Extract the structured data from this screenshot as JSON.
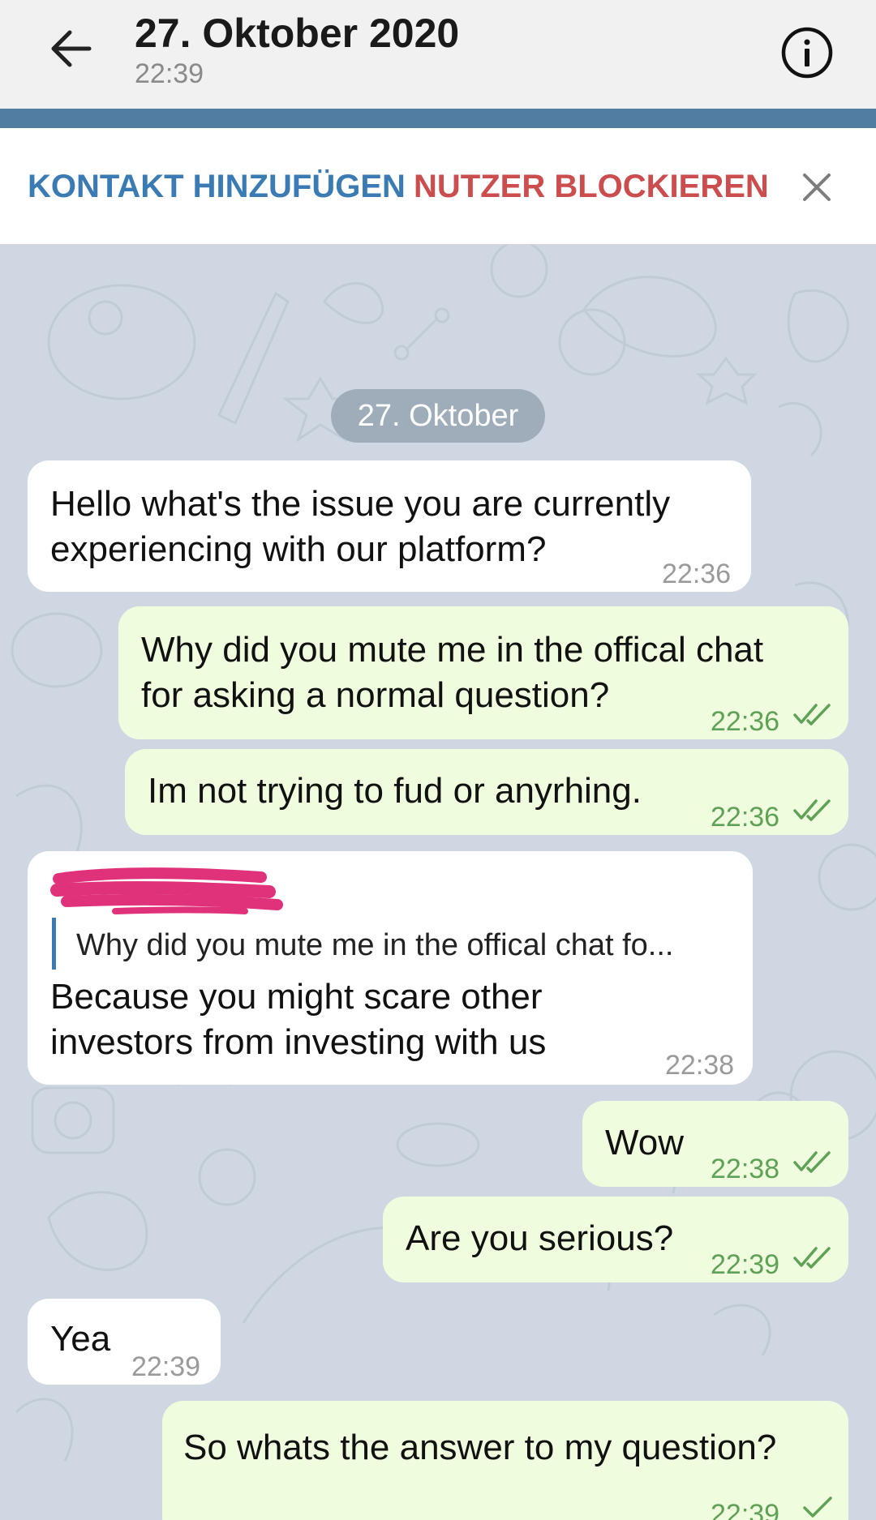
{
  "header": {
    "title": "27. Oktober 2020",
    "subtitle": "22:39",
    "back_icon": "arrow-left-icon",
    "info_icon": "info-circle-icon"
  },
  "actions": {
    "add_contact": "KONTAKT HINZUFÜGEN",
    "block_user": "NUTZER BLOCKIEREN",
    "close_icon": "close-icon"
  },
  "chat": {
    "date_pill": "27. Oktober",
    "messages": [
      {
        "direction": "in",
        "text": "Hello what's the issue you are currently\nexperiencing with our platform?",
        "time": "22:36"
      },
      {
        "direction": "out",
        "text": "Why did you mute me in the offical chat\nfor asking a normal question?",
        "time": "22:36",
        "status": "read"
      },
      {
        "direction": "out",
        "text": "Im not trying to fud or anyrhing.",
        "time": "22:36",
        "status": "read"
      },
      {
        "direction": "in",
        "reply_to": "Why did you mute me in the offical chat fo...",
        "text": "Because you might scare other\ninvestors from investing with us",
        "time": "22:38"
      },
      {
        "direction": "out",
        "text": "Wow",
        "time": "22:38",
        "status": "read"
      },
      {
        "direction": "out",
        "text": "Are you serious?",
        "time": "22:39",
        "status": "read"
      },
      {
        "direction": "in",
        "text": "Yea",
        "time": "22:39"
      },
      {
        "direction": "out",
        "text": "So whats the answer to my question?",
        "time": "22:39",
        "status": "sent"
      }
    ]
  },
  "colors": {
    "accent_blue": "#527da3",
    "link_blue": "#3b7bb4",
    "block_red": "#cc4d4d",
    "outgoing_bubble": "#effdde",
    "incoming_bubble": "#ffffff",
    "chat_background": "#cfd8e2",
    "check_green": "#5fa156",
    "redaction_pink": "#e0327a"
  }
}
